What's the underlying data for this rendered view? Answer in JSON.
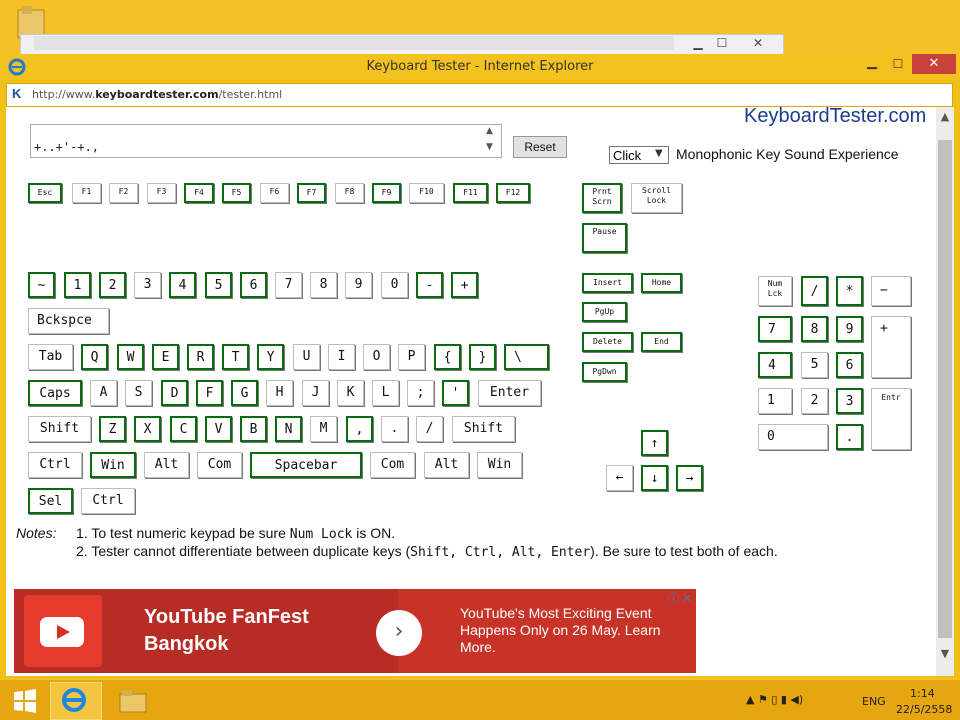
{
  "window": {
    "title": "Keyboard Tester - Internet Explorer",
    "min": "▁",
    "max": "☐",
    "close": "✕"
  },
  "back_window": {
    "min": "▁",
    "max": "☐",
    "close": "✕"
  },
  "address": {
    "icon": "K",
    "url_prefix": "http://www.",
    "url_domain": "keyboardtester.com",
    "url_suffix": "/tester.html"
  },
  "page": {
    "brand": "KeyboardTester.com",
    "textarea_value": "+..+'-+.,",
    "reset_label": "Reset",
    "sound_select": "Click",
    "sound_label": "Monophonic Key Sound Experience"
  },
  "keys": {
    "fn": [
      "Esc",
      "F1",
      "F2",
      "F3",
      "F4",
      "F5",
      "F6",
      "F7",
      "F8",
      "F9",
      "F10",
      "F11",
      "F12"
    ],
    "nav": [
      "Prnt\nScrn",
      "Scroll\nLock",
      "Pause",
      "Insert",
      "Home",
      "PgUp",
      "Delete",
      "End",
      "PgDwn"
    ],
    "row1": [
      "~",
      "1",
      "2",
      "3",
      "4",
      "5",
      "6",
      "7",
      "8",
      "9",
      "0",
      "-",
      "+"
    ],
    "backspace": "Bckspce",
    "row2": [
      "Tab",
      "Q",
      "W",
      "E",
      "R",
      "T",
      "Y",
      "U",
      "I",
      "O",
      "P",
      "{",
      "}",
      "\\"
    ],
    "row3": [
      "Caps",
      "A",
      "S",
      "D",
      "F",
      "G",
      "H",
      "J",
      "K",
      "L",
      ";",
      "'",
      "Enter"
    ],
    "row4": [
      "Shift",
      "Z",
      "X",
      "C",
      "V",
      "B",
      "N",
      "M",
      ",",
      ".",
      "/",
      "Shift"
    ],
    "row5": [
      "Ctrl",
      "Win",
      "Alt",
      "Com",
      "Spacebar",
      "Com",
      "Alt",
      "Win"
    ],
    "row6": [
      "Sel",
      "Ctrl"
    ],
    "arrows": [
      "↑",
      "←",
      "↓",
      "→"
    ],
    "numpad": [
      "Num\nLck",
      "/",
      "*",
      "−",
      "7",
      "8",
      "9",
      "+",
      "4",
      "5",
      "6",
      "1",
      "2",
      "3",
      "Entr",
      "0",
      "."
    ]
  },
  "notes": {
    "label": "Notes:",
    "n1_pre": "1.  To test numeric keypad be sure ",
    "n1_code": "Num Lock",
    "n1_post": " is ON.",
    "n2_pre": "2.  Tester cannot differentiate between duplicate keys (",
    "n2_code": "Shift, Ctrl, Alt, Enter",
    "n2_post": "). Be sure to test both of each."
  },
  "ad": {
    "title_line1": "YouTube FanFest",
    "title_line2": "Bangkok",
    "text": "YouTube's Most Exciting Event Happens Only on 26 May. Learn More.",
    "arrow": "›",
    "close": "ⓘ ✕"
  },
  "taskbar": {
    "tray": "▲  ⚑  ▯  ▮  ◀)",
    "lang": "ENG",
    "time": "1:14",
    "date": "22/5/2558"
  }
}
